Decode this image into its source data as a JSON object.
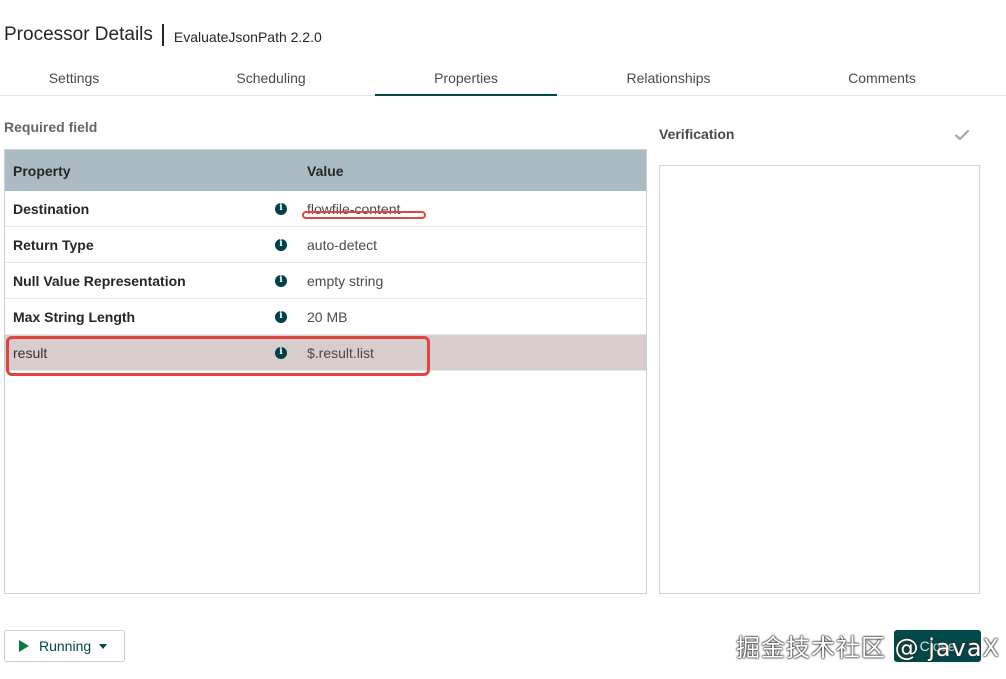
{
  "header": {
    "title": "Processor Details",
    "subtitle": "EvaluateJsonPath 2.2.0"
  },
  "tabs": [
    {
      "label": "Settings"
    },
    {
      "label": "Scheduling"
    },
    {
      "label": "Properties",
      "active": true
    },
    {
      "label": "Relationships"
    },
    {
      "label": "Comments"
    }
  ],
  "required_label": "Required field",
  "table": {
    "headers": {
      "property": "Property",
      "value": "Value"
    },
    "rows": [
      {
        "property": "Destination",
        "value": "flowfile-content",
        "info_icon": "info-icon"
      },
      {
        "property": "Return Type",
        "value": "auto-detect",
        "info_icon": "info-icon"
      },
      {
        "property": "Null Value Representation",
        "value": "empty string",
        "info_icon": "info-icon"
      },
      {
        "property": "Max String Length",
        "value": "20 MB",
        "info_icon": "info-icon"
      },
      {
        "property": "result",
        "value": "$.result.list",
        "info_icon": "info-icon",
        "user_defined": true
      }
    ]
  },
  "verification": {
    "title": "Verification",
    "icon": "check-icon"
  },
  "footer": {
    "run_label": "Running",
    "close_label": "Close"
  },
  "watermark": "掘金技术社区 @ javaX",
  "colors": {
    "accent": "#004849",
    "table_header": "#aabbc3",
    "user_row": "#d8cccc",
    "annotation": "#e0453d",
    "info_icon": "#00404a"
  }
}
